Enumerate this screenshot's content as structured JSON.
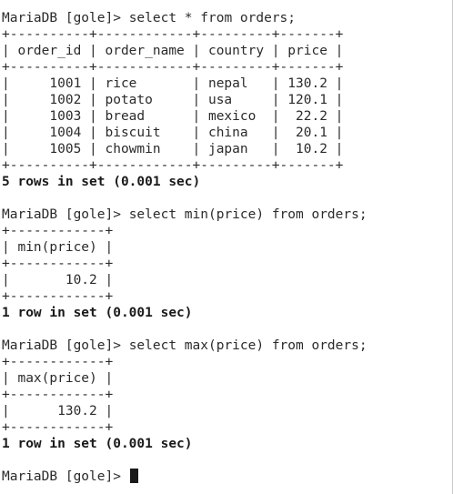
{
  "terminal": {
    "clipped_top_line": "                                   ",
    "queries": [
      {
        "prompt": "MariaDB [gole]> ",
        "command": "select * from orders;",
        "result_lines": [
          "+----------+------------+---------+-------+",
          "| order_id | order_name | country | price |",
          "+----------+------------+---------+-------+",
          "|     1001 | rice       | nepal   | 130.2 |",
          "|     1002 | potato     | usa     | 120.1 |",
          "|     1003 | bread      | mexico  |  22.2 |",
          "|     1004 | biscuit    | china   |  20.1 |",
          "|     1005 | chowmin    | japan   |  10.2 |",
          "+----------+------------+---------+-------+"
        ],
        "status": "5 rows in set (0.001 sec)"
      },
      {
        "prompt": "MariaDB [gole]> ",
        "command": "select min(price) from orders;",
        "result_lines": [
          "+------------+",
          "| min(price) |",
          "+------------+",
          "|       10.2 |",
          "+------------+"
        ],
        "status": "1 row in set (0.001 sec)"
      },
      {
        "prompt": "MariaDB [gole]> ",
        "command": "select max(price) from orders;",
        "result_lines": [
          "+------------+",
          "| max(price) |",
          "+------------+",
          "|      130.2 |",
          "+------------+"
        ],
        "status": "1 row in set (0.001 sec)"
      }
    ],
    "current_prompt": "MariaDB [gole]> "
  }
}
